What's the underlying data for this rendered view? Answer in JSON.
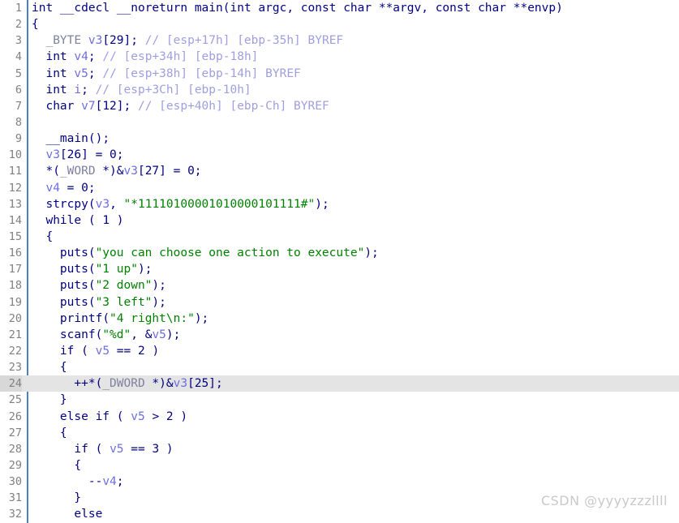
{
  "editor": {
    "kind": "decompiler-pseudocode-view",
    "colors": {
      "background": "#ffffff",
      "gutter_rule": "#4a80c8",
      "line_number": "#808080",
      "current_line_highlight": "#e4e4e4",
      "keyword": "#000080",
      "variable": "#6e6ee0",
      "string": "#008000",
      "comment": "#9f9fe0",
      "macro_type": "#8080a0",
      "watermark": "#c9c9c9"
    },
    "current_line": 24,
    "total_lines": 32
  },
  "watermark": {
    "text": "CSDN @yyyyzzzllll"
  },
  "lines": [
    {
      "n": "1",
      "tokens": [
        {
          "c": "t-kw",
          "t": "int"
        },
        {
          "c": "t-plain",
          "t": " "
        },
        {
          "c": "t-kw",
          "t": "__cdecl"
        },
        {
          "c": "t-plain",
          "t": " "
        },
        {
          "c": "t-kw",
          "t": "__noreturn"
        },
        {
          "c": "t-plain",
          "t": " "
        },
        {
          "c": "t-fn",
          "t": "main"
        },
        {
          "c": "t-plain",
          "t": "("
        },
        {
          "c": "t-kw",
          "t": "int"
        },
        {
          "c": "t-plain",
          "t": " argc, "
        },
        {
          "c": "t-kw",
          "t": "const"
        },
        {
          "c": "t-plain",
          "t": " "
        },
        {
          "c": "t-kw",
          "t": "char"
        },
        {
          "c": "t-plain",
          "t": " **argv, "
        },
        {
          "c": "t-kw",
          "t": "const"
        },
        {
          "c": "t-plain",
          "t": " "
        },
        {
          "c": "t-kw",
          "t": "char"
        },
        {
          "c": "t-plain",
          "t": " **envp)"
        }
      ]
    },
    {
      "n": "2",
      "tokens": [
        {
          "c": "t-plain",
          "t": "{"
        }
      ]
    },
    {
      "n": "3",
      "tokens": [
        {
          "c": "t-plain",
          "t": "  "
        },
        {
          "c": "t-macro",
          "t": "_BYTE"
        },
        {
          "c": "t-plain",
          "t": " "
        },
        {
          "c": "t-var",
          "t": "v3"
        },
        {
          "c": "t-plain",
          "t": "[29]; "
        },
        {
          "c": "t-cmt",
          "t": "// [esp+17h] [ebp-35h] BYREF"
        }
      ]
    },
    {
      "n": "4",
      "tokens": [
        {
          "c": "t-plain",
          "t": "  "
        },
        {
          "c": "t-kw",
          "t": "int"
        },
        {
          "c": "t-plain",
          "t": " "
        },
        {
          "c": "t-var",
          "t": "v4"
        },
        {
          "c": "t-plain",
          "t": "; "
        },
        {
          "c": "t-cmt",
          "t": "// [esp+34h] [ebp-18h]"
        }
      ]
    },
    {
      "n": "5",
      "tokens": [
        {
          "c": "t-plain",
          "t": "  "
        },
        {
          "c": "t-kw",
          "t": "int"
        },
        {
          "c": "t-plain",
          "t": " "
        },
        {
          "c": "t-var",
          "t": "v5"
        },
        {
          "c": "t-plain",
          "t": "; "
        },
        {
          "c": "t-cmt",
          "t": "// [esp+38h] [ebp-14h] BYREF"
        }
      ]
    },
    {
      "n": "6",
      "tokens": [
        {
          "c": "t-plain",
          "t": "  "
        },
        {
          "c": "t-kw",
          "t": "int"
        },
        {
          "c": "t-plain",
          "t": " "
        },
        {
          "c": "t-var",
          "t": "i"
        },
        {
          "c": "t-plain",
          "t": "; "
        },
        {
          "c": "t-cmt",
          "t": "// [esp+3Ch] [ebp-10h]"
        }
      ]
    },
    {
      "n": "7",
      "tokens": [
        {
          "c": "t-plain",
          "t": "  "
        },
        {
          "c": "t-kw",
          "t": "char"
        },
        {
          "c": "t-plain",
          "t": " "
        },
        {
          "c": "t-var",
          "t": "v7"
        },
        {
          "c": "t-plain",
          "t": "[12]; "
        },
        {
          "c": "t-cmt",
          "t": "// [esp+40h] [ebp-Ch] BYREF"
        }
      ]
    },
    {
      "n": "8",
      "tokens": []
    },
    {
      "n": "9",
      "tokens": [
        {
          "c": "t-plain",
          "t": "  "
        },
        {
          "c": "t-fn",
          "t": "__main"
        },
        {
          "c": "t-plain",
          "t": "();"
        }
      ]
    },
    {
      "n": "10",
      "tokens": [
        {
          "c": "t-plain",
          "t": "  "
        },
        {
          "c": "t-var",
          "t": "v3"
        },
        {
          "c": "t-plain",
          "t": "[26] = 0;"
        }
      ]
    },
    {
      "n": "11",
      "tokens": [
        {
          "c": "t-plain",
          "t": "  *("
        },
        {
          "c": "t-macro",
          "t": "_WORD"
        },
        {
          "c": "t-plain",
          "t": " *)&"
        },
        {
          "c": "t-var",
          "t": "v3"
        },
        {
          "c": "t-plain",
          "t": "[27] = 0;"
        }
      ]
    },
    {
      "n": "12",
      "tokens": [
        {
          "c": "t-plain",
          "t": "  "
        },
        {
          "c": "t-var",
          "t": "v4"
        },
        {
          "c": "t-plain",
          "t": " = 0;"
        }
      ]
    },
    {
      "n": "13",
      "tokens": [
        {
          "c": "t-plain",
          "t": "  "
        },
        {
          "c": "t-fn",
          "t": "strcpy"
        },
        {
          "c": "t-plain",
          "t": "("
        },
        {
          "c": "t-var",
          "t": "v3"
        },
        {
          "c": "t-plain",
          "t": ", "
        },
        {
          "c": "t-str",
          "t": "\"*11110100001010000101111#\""
        },
        {
          "c": "t-plain",
          "t": ");"
        }
      ]
    },
    {
      "n": "14",
      "tokens": [
        {
          "c": "t-plain",
          "t": "  "
        },
        {
          "c": "t-kw",
          "t": "while"
        },
        {
          "c": "t-plain",
          "t": " ( 1 )"
        }
      ]
    },
    {
      "n": "15",
      "tokens": [
        {
          "c": "t-plain",
          "t": "  {"
        }
      ]
    },
    {
      "n": "16",
      "tokens": [
        {
          "c": "t-plain",
          "t": "    "
        },
        {
          "c": "t-fn",
          "t": "puts"
        },
        {
          "c": "t-plain",
          "t": "("
        },
        {
          "c": "t-str",
          "t": "\"you can choose one action to execute\""
        },
        {
          "c": "t-plain",
          "t": ");"
        }
      ]
    },
    {
      "n": "17",
      "tokens": [
        {
          "c": "t-plain",
          "t": "    "
        },
        {
          "c": "t-fn",
          "t": "puts"
        },
        {
          "c": "t-plain",
          "t": "("
        },
        {
          "c": "t-str",
          "t": "\"1 up\""
        },
        {
          "c": "t-plain",
          "t": ");"
        }
      ]
    },
    {
      "n": "18",
      "tokens": [
        {
          "c": "t-plain",
          "t": "    "
        },
        {
          "c": "t-fn",
          "t": "puts"
        },
        {
          "c": "t-plain",
          "t": "("
        },
        {
          "c": "t-str",
          "t": "\"2 down\""
        },
        {
          "c": "t-plain",
          "t": ");"
        }
      ]
    },
    {
      "n": "19",
      "tokens": [
        {
          "c": "t-plain",
          "t": "    "
        },
        {
          "c": "t-fn",
          "t": "puts"
        },
        {
          "c": "t-plain",
          "t": "("
        },
        {
          "c": "t-str",
          "t": "\"3 left\""
        },
        {
          "c": "t-plain",
          "t": ");"
        }
      ]
    },
    {
      "n": "20",
      "tokens": [
        {
          "c": "t-plain",
          "t": "    "
        },
        {
          "c": "t-fn",
          "t": "printf"
        },
        {
          "c": "t-plain",
          "t": "("
        },
        {
          "c": "t-str",
          "t": "\"4 right\\n:\""
        },
        {
          "c": "t-plain",
          "t": ");"
        }
      ]
    },
    {
      "n": "21",
      "tokens": [
        {
          "c": "t-plain",
          "t": "    "
        },
        {
          "c": "t-fn",
          "t": "scanf"
        },
        {
          "c": "t-plain",
          "t": "("
        },
        {
          "c": "t-str",
          "t": "\"%d\""
        },
        {
          "c": "t-plain",
          "t": ", &"
        },
        {
          "c": "t-var",
          "t": "v5"
        },
        {
          "c": "t-plain",
          "t": ");"
        }
      ]
    },
    {
      "n": "22",
      "tokens": [
        {
          "c": "t-plain",
          "t": "    "
        },
        {
          "c": "t-kw",
          "t": "if"
        },
        {
          "c": "t-plain",
          "t": " ( "
        },
        {
          "c": "t-var",
          "t": "v5"
        },
        {
          "c": "t-plain",
          "t": " == 2 )"
        }
      ]
    },
    {
      "n": "23",
      "tokens": [
        {
          "c": "t-plain",
          "t": "    {"
        }
      ]
    },
    {
      "n": "24",
      "tokens": [
        {
          "c": "t-plain",
          "t": "      ++*("
        },
        {
          "c": "t-macro",
          "t": "_DWORD"
        },
        {
          "c": "t-plain",
          "t": " *)&"
        },
        {
          "c": "t-var",
          "t": "v3"
        },
        {
          "c": "t-plain",
          "t": "[25];"
        }
      ]
    },
    {
      "n": "25",
      "tokens": [
        {
          "c": "t-plain",
          "t": "    }"
        }
      ]
    },
    {
      "n": "26",
      "tokens": [
        {
          "c": "t-plain",
          "t": "    "
        },
        {
          "c": "t-kw",
          "t": "else"
        },
        {
          "c": "t-plain",
          "t": " "
        },
        {
          "c": "t-kw",
          "t": "if"
        },
        {
          "c": "t-plain",
          "t": " ( "
        },
        {
          "c": "t-var",
          "t": "v5"
        },
        {
          "c": "t-plain",
          "t": " > 2 )"
        }
      ]
    },
    {
      "n": "27",
      "tokens": [
        {
          "c": "t-plain",
          "t": "    {"
        }
      ]
    },
    {
      "n": "28",
      "tokens": [
        {
          "c": "t-plain",
          "t": "      "
        },
        {
          "c": "t-kw",
          "t": "if"
        },
        {
          "c": "t-plain",
          "t": " ( "
        },
        {
          "c": "t-var",
          "t": "v5"
        },
        {
          "c": "t-plain",
          "t": " == 3 )"
        }
      ]
    },
    {
      "n": "29",
      "tokens": [
        {
          "c": "t-plain",
          "t": "      {"
        }
      ]
    },
    {
      "n": "30",
      "tokens": [
        {
          "c": "t-plain",
          "t": "        --"
        },
        {
          "c": "t-var",
          "t": "v4"
        },
        {
          "c": "t-plain",
          "t": ";"
        }
      ]
    },
    {
      "n": "31",
      "tokens": [
        {
          "c": "t-plain",
          "t": "      }"
        }
      ]
    },
    {
      "n": "32",
      "tokens": [
        {
          "c": "t-plain",
          "t": "      "
        },
        {
          "c": "t-kw",
          "t": "else"
        }
      ]
    }
  ],
  "plain_text_lines": [
    "int __cdecl __noreturn main(int argc, const char **argv, const char **envp)",
    "{",
    "  _BYTE v3[29]; // [esp+17h] [ebp-35h] BYREF",
    "  int v4; // [esp+34h] [ebp-18h]",
    "  int v5; // [esp+38h] [ebp-14h] BYREF",
    "  int i; // [esp+3Ch] [ebp-10h]",
    "  char v7[12]; // [esp+40h] [ebp-Ch] BYREF",
    "",
    "  __main();",
    "  v3[26] = 0;",
    "  *(_WORD *)&v3[27] = 0;",
    "  v4 = 0;",
    "  strcpy(v3, \"*11110100001010000101111#\");",
    "  while ( 1 )",
    "  {",
    "    puts(\"you can choose one action to execute\");",
    "    puts(\"1 up\");",
    "    puts(\"2 down\");",
    "    puts(\"3 left\");",
    "    printf(\"4 right\\n:\");",
    "    scanf(\"%d\", &v5);",
    "    if ( v5 == 2 )",
    "    {",
    "      ++*(_DWORD *)&v3[25];",
    "    }",
    "    else if ( v5 > 2 )",
    "    {",
    "      if ( v5 == 3 )",
    "      {",
    "        --v4;",
    "      }",
    "      else"
  ]
}
